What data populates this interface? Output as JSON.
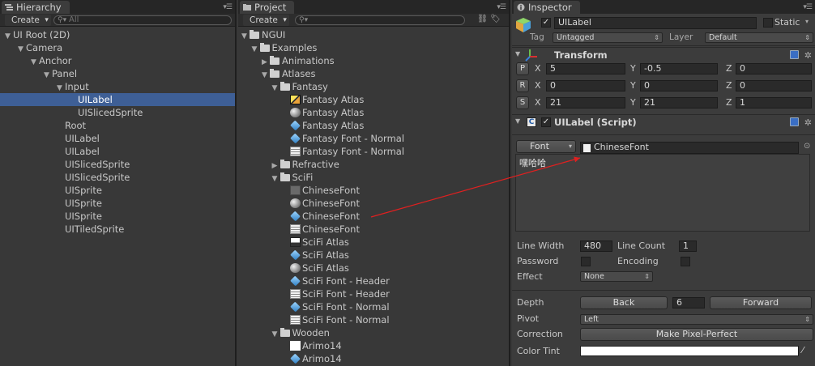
{
  "colors": {
    "selection": "#3e5f96",
    "arrow": "#e02020",
    "panel": "#383838"
  },
  "hierarchy": {
    "tab_label": "Hierarchy",
    "create_label": "Create",
    "search_placeholder": "All",
    "items": [
      {
        "label": "UI Root (2D)",
        "indent": 0,
        "arrow": "▼"
      },
      {
        "label": "Camera",
        "indent": 1,
        "arrow": "▼"
      },
      {
        "label": "Anchor",
        "indent": 2,
        "arrow": "▼"
      },
      {
        "label": "Panel",
        "indent": 3,
        "arrow": "▼"
      },
      {
        "label": "Input",
        "indent": 4,
        "arrow": "▼"
      },
      {
        "label": "UILabel",
        "indent": 5,
        "arrow": "",
        "selected": true
      },
      {
        "label": "UISlicedSprite",
        "indent": 5,
        "arrow": ""
      },
      {
        "label": "Root",
        "indent": 4,
        "arrow": ""
      },
      {
        "label": "UILabel",
        "indent": 4,
        "arrow": ""
      },
      {
        "label": "UILabel",
        "indent": 4,
        "arrow": ""
      },
      {
        "label": "UISlicedSprite",
        "indent": 4,
        "arrow": ""
      },
      {
        "label": "UISlicedSprite",
        "indent": 4,
        "arrow": ""
      },
      {
        "label": "UISprite",
        "indent": 4,
        "arrow": ""
      },
      {
        "label": "UISprite",
        "indent": 4,
        "arrow": ""
      },
      {
        "label": "UISprite",
        "indent": 4,
        "arrow": ""
      },
      {
        "label": "UITiledSprite",
        "indent": 4,
        "arrow": ""
      }
    ]
  },
  "project": {
    "tab_label": "Project",
    "create_label": "Create",
    "items": [
      {
        "label": "NGUI",
        "indent": 0,
        "arrow": "▼",
        "icon": "folder"
      },
      {
        "label": "Examples",
        "indent": 1,
        "arrow": "▼",
        "icon": "folder"
      },
      {
        "label": "Animations",
        "indent": 2,
        "arrow": "▶",
        "icon": "folder"
      },
      {
        "label": "Atlases",
        "indent": 2,
        "arrow": "▼",
        "icon": "folder"
      },
      {
        "label": "Fantasy",
        "indent": 3,
        "arrow": "▼",
        "icon": "folder"
      },
      {
        "label": "Fantasy Atlas",
        "indent": 4,
        "arrow": "",
        "icon": "atlas"
      },
      {
        "label": "Fantasy Atlas",
        "indent": 4,
        "arrow": "",
        "icon": "sphere"
      },
      {
        "label": "Fantasy Atlas",
        "indent": 4,
        "arrow": "",
        "icon": "cube"
      },
      {
        "label": "Fantasy Font - Normal",
        "indent": 4,
        "arrow": "",
        "icon": "cube"
      },
      {
        "label": "Fantasy Font - Normal",
        "indent": 4,
        "arrow": "",
        "icon": "doc"
      },
      {
        "label": "Refractive",
        "indent": 3,
        "arrow": "▶",
        "icon": "folder"
      },
      {
        "label": "SciFi",
        "indent": 3,
        "arrow": "▼",
        "icon": "folder"
      },
      {
        "label": "ChineseFont",
        "indent": 4,
        "arrow": "",
        "icon": "tex"
      },
      {
        "label": "ChineseFont",
        "indent": 4,
        "arrow": "",
        "icon": "sphere"
      },
      {
        "label": "ChineseFont",
        "indent": 4,
        "arrow": "",
        "icon": "cube"
      },
      {
        "label": "ChineseFont",
        "indent": 4,
        "arrow": "",
        "icon": "doc"
      },
      {
        "label": "SciFi Atlas",
        "indent": 4,
        "arrow": "",
        "icon": "sprite"
      },
      {
        "label": "SciFi Atlas",
        "indent": 4,
        "arrow": "",
        "icon": "cube"
      },
      {
        "label": "SciFi Atlas",
        "indent": 4,
        "arrow": "",
        "icon": "sphere"
      },
      {
        "label": "SciFi Font - Header",
        "indent": 4,
        "arrow": "",
        "icon": "cube"
      },
      {
        "label": "SciFi Font - Header",
        "indent": 4,
        "arrow": "",
        "icon": "doc"
      },
      {
        "label": "SciFi Font - Normal",
        "indent": 4,
        "arrow": "",
        "icon": "cube"
      },
      {
        "label": "SciFi Font - Normal",
        "indent": 4,
        "arrow": "",
        "icon": "doc"
      },
      {
        "label": "Wooden",
        "indent": 3,
        "arrow": "▼",
        "icon": "folder"
      },
      {
        "label": "Arimo14",
        "indent": 4,
        "arrow": "",
        "icon": "white"
      },
      {
        "label": "Arimo14",
        "indent": 4,
        "arrow": "",
        "icon": "cube"
      }
    ]
  },
  "inspector": {
    "tab_label": "Inspector",
    "object_name": "UILabel",
    "static_label": "Static",
    "tag_label": "Tag",
    "tag_value": "Untagged",
    "layer_label": "Layer",
    "layer_value": "Default",
    "transform": {
      "title": "Transform",
      "rows": [
        {
          "btn": "P",
          "x": "5",
          "y": "-0.5",
          "z": "0"
        },
        {
          "btn": "R",
          "x": "0",
          "y": "0",
          "z": "0"
        },
        {
          "btn": "S",
          "x": "21",
          "y": "21",
          "z": "1"
        }
      ],
      "x_label": "X",
      "y_label": "Y",
      "z_label": "Z"
    },
    "script": {
      "title": "UILabel (Script)",
      "font_button": "Font",
      "font_value": "ChineseFont",
      "text": "嘿哈哈",
      "line_width_label": "Line Width",
      "line_width": "480",
      "line_count_label": "Line Count",
      "line_count": "1",
      "password_label": "Password",
      "encoding_label": "Encoding",
      "effect_label": "Effect",
      "effect_value": "None",
      "depth_label": "Depth",
      "back_button": "Back",
      "depth_value": "6",
      "forward_button": "Forward",
      "pivot_label": "Pivot",
      "pivot_value": "Left",
      "correction_label": "Correction",
      "pixel_perfect_button": "Make Pixel-Perfect",
      "color_tint_label": "Color Tint"
    }
  }
}
